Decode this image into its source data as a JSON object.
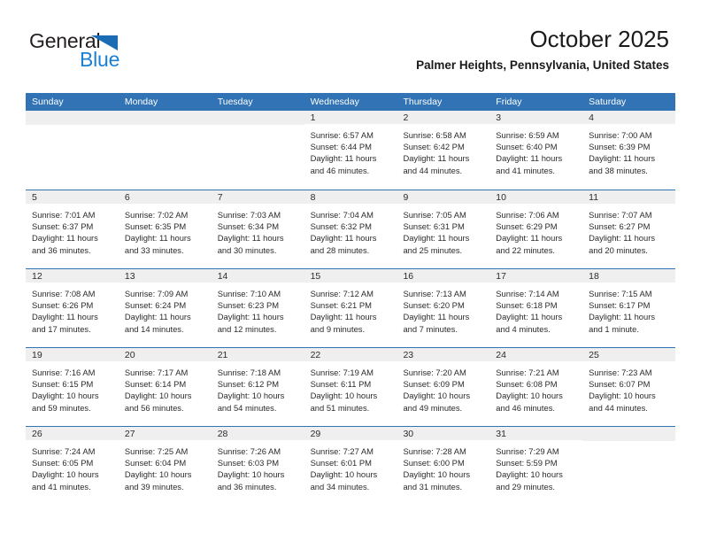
{
  "logo": {
    "word1": "General",
    "word2": "Blue",
    "triangle_icon": "triangle-icon",
    "color_dark": "#231f20",
    "color_blue": "#1b7fd4"
  },
  "header": {
    "title": "October 2025",
    "subtitle": "Palmer Heights, Pennsylvania, United States"
  },
  "theme": {
    "header_blue": "#3173b4",
    "day_band_gray": "#efefef"
  },
  "calendar": {
    "day_names": [
      "Sunday",
      "Monday",
      "Tuesday",
      "Wednesday",
      "Thursday",
      "Friday",
      "Saturday"
    ],
    "weeks": [
      [
        {
          "day": "",
          "lines": []
        },
        {
          "day": "",
          "lines": []
        },
        {
          "day": "",
          "lines": []
        },
        {
          "day": "1",
          "lines": [
            "Sunrise: 6:57 AM",
            "Sunset: 6:44 PM",
            "Daylight: 11 hours",
            "and 46 minutes."
          ]
        },
        {
          "day": "2",
          "lines": [
            "Sunrise: 6:58 AM",
            "Sunset: 6:42 PM",
            "Daylight: 11 hours",
            "and 44 minutes."
          ]
        },
        {
          "day": "3",
          "lines": [
            "Sunrise: 6:59 AM",
            "Sunset: 6:40 PM",
            "Daylight: 11 hours",
            "and 41 minutes."
          ]
        },
        {
          "day": "4",
          "lines": [
            "Sunrise: 7:00 AM",
            "Sunset: 6:39 PM",
            "Daylight: 11 hours",
            "and 38 minutes."
          ]
        }
      ],
      [
        {
          "day": "5",
          "lines": [
            "Sunrise: 7:01 AM",
            "Sunset: 6:37 PM",
            "Daylight: 11 hours",
            "and 36 minutes."
          ]
        },
        {
          "day": "6",
          "lines": [
            "Sunrise: 7:02 AM",
            "Sunset: 6:35 PM",
            "Daylight: 11 hours",
            "and 33 minutes."
          ]
        },
        {
          "day": "7",
          "lines": [
            "Sunrise: 7:03 AM",
            "Sunset: 6:34 PM",
            "Daylight: 11 hours",
            "and 30 minutes."
          ]
        },
        {
          "day": "8",
          "lines": [
            "Sunrise: 7:04 AM",
            "Sunset: 6:32 PM",
            "Daylight: 11 hours",
            "and 28 minutes."
          ]
        },
        {
          "day": "9",
          "lines": [
            "Sunrise: 7:05 AM",
            "Sunset: 6:31 PM",
            "Daylight: 11 hours",
            "and 25 minutes."
          ]
        },
        {
          "day": "10",
          "lines": [
            "Sunrise: 7:06 AM",
            "Sunset: 6:29 PM",
            "Daylight: 11 hours",
            "and 22 minutes."
          ]
        },
        {
          "day": "11",
          "lines": [
            "Sunrise: 7:07 AM",
            "Sunset: 6:27 PM",
            "Daylight: 11 hours",
            "and 20 minutes."
          ]
        }
      ],
      [
        {
          "day": "12",
          "lines": [
            "Sunrise: 7:08 AM",
            "Sunset: 6:26 PM",
            "Daylight: 11 hours",
            "and 17 minutes."
          ]
        },
        {
          "day": "13",
          "lines": [
            "Sunrise: 7:09 AM",
            "Sunset: 6:24 PM",
            "Daylight: 11 hours",
            "and 14 minutes."
          ]
        },
        {
          "day": "14",
          "lines": [
            "Sunrise: 7:10 AM",
            "Sunset: 6:23 PM",
            "Daylight: 11 hours",
            "and 12 minutes."
          ]
        },
        {
          "day": "15",
          "lines": [
            "Sunrise: 7:12 AM",
            "Sunset: 6:21 PM",
            "Daylight: 11 hours",
            "and 9 minutes."
          ]
        },
        {
          "day": "16",
          "lines": [
            "Sunrise: 7:13 AM",
            "Sunset: 6:20 PM",
            "Daylight: 11 hours",
            "and 7 minutes."
          ]
        },
        {
          "day": "17",
          "lines": [
            "Sunrise: 7:14 AM",
            "Sunset: 6:18 PM",
            "Daylight: 11 hours",
            "and 4 minutes."
          ]
        },
        {
          "day": "18",
          "lines": [
            "Sunrise: 7:15 AM",
            "Sunset: 6:17 PM",
            "Daylight: 11 hours",
            "and 1 minute."
          ]
        }
      ],
      [
        {
          "day": "19",
          "lines": [
            "Sunrise: 7:16 AM",
            "Sunset: 6:15 PM",
            "Daylight: 10 hours",
            "and 59 minutes."
          ]
        },
        {
          "day": "20",
          "lines": [
            "Sunrise: 7:17 AM",
            "Sunset: 6:14 PM",
            "Daylight: 10 hours",
            "and 56 minutes."
          ]
        },
        {
          "day": "21",
          "lines": [
            "Sunrise: 7:18 AM",
            "Sunset: 6:12 PM",
            "Daylight: 10 hours",
            "and 54 minutes."
          ]
        },
        {
          "day": "22",
          "lines": [
            "Sunrise: 7:19 AM",
            "Sunset: 6:11 PM",
            "Daylight: 10 hours",
            "and 51 minutes."
          ]
        },
        {
          "day": "23",
          "lines": [
            "Sunrise: 7:20 AM",
            "Sunset: 6:09 PM",
            "Daylight: 10 hours",
            "and 49 minutes."
          ]
        },
        {
          "day": "24",
          "lines": [
            "Sunrise: 7:21 AM",
            "Sunset: 6:08 PM",
            "Daylight: 10 hours",
            "and 46 minutes."
          ]
        },
        {
          "day": "25",
          "lines": [
            "Sunrise: 7:23 AM",
            "Sunset: 6:07 PM",
            "Daylight: 10 hours",
            "and 44 minutes."
          ]
        }
      ],
      [
        {
          "day": "26",
          "lines": [
            "Sunrise: 7:24 AM",
            "Sunset: 6:05 PM",
            "Daylight: 10 hours",
            "and 41 minutes."
          ]
        },
        {
          "day": "27",
          "lines": [
            "Sunrise: 7:25 AM",
            "Sunset: 6:04 PM",
            "Daylight: 10 hours",
            "and 39 minutes."
          ]
        },
        {
          "day": "28",
          "lines": [
            "Sunrise: 7:26 AM",
            "Sunset: 6:03 PM",
            "Daylight: 10 hours",
            "and 36 minutes."
          ]
        },
        {
          "day": "29",
          "lines": [
            "Sunrise: 7:27 AM",
            "Sunset: 6:01 PM",
            "Daylight: 10 hours",
            "and 34 minutes."
          ]
        },
        {
          "day": "30",
          "lines": [
            "Sunrise: 7:28 AM",
            "Sunset: 6:00 PM",
            "Daylight: 10 hours",
            "and 31 minutes."
          ]
        },
        {
          "day": "31",
          "lines": [
            "Sunrise: 7:29 AM",
            "Sunset: 5:59 PM",
            "Daylight: 10 hours",
            "and 29 minutes."
          ]
        },
        {
          "day": "",
          "lines": []
        }
      ]
    ]
  }
}
